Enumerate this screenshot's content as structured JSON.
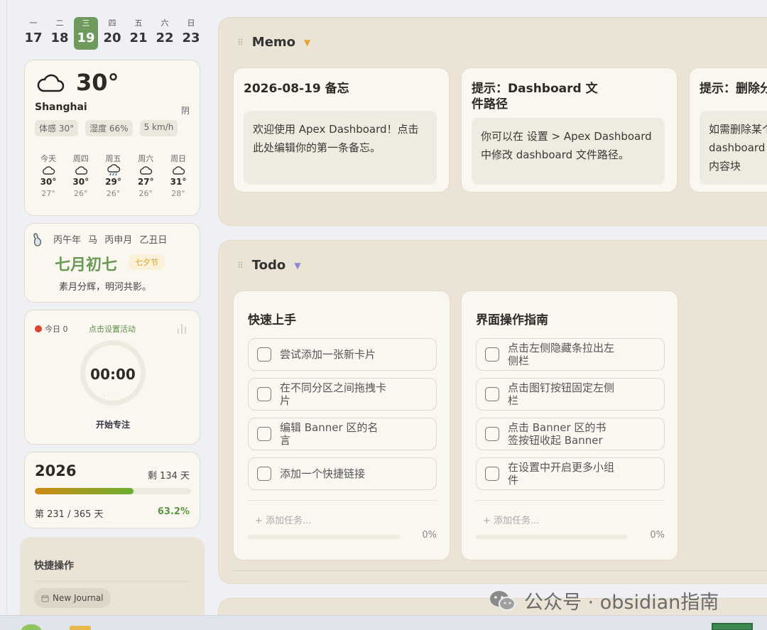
{
  "week": {
    "days": [
      {
        "wd": "一",
        "d": "17"
      },
      {
        "wd": "二",
        "d": "18"
      },
      {
        "wd": "三",
        "d": "19"
      },
      {
        "wd": "四",
        "d": "20"
      },
      {
        "wd": "五",
        "d": "21"
      },
      {
        "wd": "六",
        "d": "22"
      },
      {
        "wd": "日",
        "d": "23"
      }
    ],
    "active_index": 2,
    "accent": "#6f9a5e"
  },
  "weather": {
    "temp": "30°",
    "city": "Shanghai",
    "condition": "阴",
    "icon": "cloud-icon",
    "pills": [
      "体感 30°",
      "湿度 66%",
      "5 km/h"
    ],
    "forecast": [
      {
        "day": "今天",
        "icon": "cloud-icon",
        "high": "30°",
        "low": "27°"
      },
      {
        "day": "周四",
        "icon": "cloud-icon",
        "high": "30°",
        "low": "26°"
      },
      {
        "day": "周五",
        "icon": "rain-cloud-icon",
        "high": "29°",
        "low": "26°"
      },
      {
        "day": "周六",
        "icon": "cloud-icon",
        "high": "27°",
        "low": "26°"
      },
      {
        "day": "周日",
        "icon": "cloud-icon",
        "high": "31°",
        "low": "28°"
      }
    ]
  },
  "lunar": {
    "top": "丙午年 马 丙申月 乙丑日",
    "main": "七月初七",
    "tag": "七夕节",
    "poem": "素月分辉，明河共影。"
  },
  "focus": {
    "today": "今日 0",
    "set_activity": "点击设置活动",
    "time": "00:00",
    "dots": "····",
    "start": "开始专注"
  },
  "year": {
    "title": "2026",
    "remaining": "剩 134 天",
    "progress_fraction": 0.632,
    "day_text": "第 231 / 365 天",
    "percent": "63.2%"
  },
  "quick": {
    "title": "快捷操作",
    "button": "New Journal"
  },
  "memo": {
    "title": "Memo",
    "cards": [
      {
        "title": "2026-08-19 备忘",
        "body": "欢迎使用 Apex Dashboard！点击此处编辑你的第一条备忘。"
      },
      {
        "title": "提示：Dashboard 文件路径",
        "body": "你可以在 设置 > Apex Dashboard 中修改 dashboard 文件路径。"
      },
      {
        "title": "提示：删除分",
        "body": "如需删除某个 dashboard 分区内容块"
      }
    ]
  },
  "todo": {
    "title": "Todo",
    "cards": [
      {
        "title": "快速上手",
        "tasks": [
          "尝试添加一张新卡片",
          "在不同分区之间拖拽卡片",
          "编辑 Banner 区的名言",
          "添加一个快捷链接"
        ],
        "add": "+ 添加任务...",
        "percent": "0%"
      },
      {
        "title": "界面操作指南",
        "tasks": [
          "点击左侧隐藏条拉出左侧栏",
          "点击图钉按钮固定左侧栏",
          "点击 Banner 区的书签按钮收起 Banner",
          "在设置中开启更多小组件"
        ],
        "add": "+ 添加任务...",
        "percent": "0%"
      }
    ]
  },
  "watermark": "公众号 · obsidian指南"
}
